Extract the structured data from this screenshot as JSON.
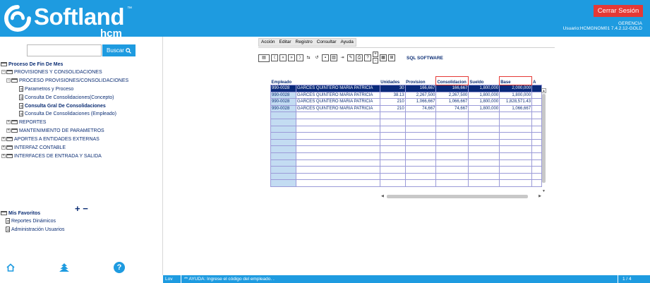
{
  "brand": {
    "name": "Softland",
    "tm": "™",
    "sub": "hcm"
  },
  "header": {
    "logout_label": "Cerrar Sesión",
    "area": "GERENCIA",
    "user_line": "Usuario:HCMGNOM01 7.4.2.12-GOLD"
  },
  "sidebar": {
    "search_placeholder": "",
    "search_label": "Buscar",
    "tree": [
      {
        "label": "Proceso De Fin De Mes",
        "bold": true
      },
      {
        "label": "PROVISIONES Y CONSOLIDACIONES"
      },
      {
        "label": "PROCESO PROVISIONES/CONSOLIDACIONES"
      },
      {
        "label": "Parametros y Proceso"
      },
      {
        "label": "Consulta De Consolidaciones(Concepto)"
      },
      {
        "label": "Consulta Gral De Consolidaciones",
        "bold": true
      },
      {
        "label": "Consulta De Consolidaciones (Empleado)"
      },
      {
        "label": "REPORTES"
      },
      {
        "label": "MANTENIMIENTO DE PARAMETROS"
      },
      {
        "label": "APORTES A ENTIDADES EXTERNAS"
      },
      {
        "label": "INTERFAZ CONTABLE"
      },
      {
        "label": "INTERFACES DE ENTRADA Y SALIDA"
      }
    ],
    "expand_collapse": "+ −",
    "favorites_title": "Mis Favoritos",
    "favorites": [
      {
        "label": "Reportes Dinámicos"
      },
      {
        "label": "Administración Usuarios"
      }
    ],
    "bottom_icons": [
      "home-icon",
      "tree-icon",
      "help-icon"
    ],
    "help_glyph": "?"
  },
  "menubar": {
    "items": [
      "Acción",
      "Editar",
      "Registro",
      "Consultar",
      "Ayuda"
    ]
  },
  "toolbar": {
    "brand": "SQL SOFTWARE"
  },
  "grid": {
    "headers": [
      "Empleado",
      "",
      "Unidades",
      "Provision",
      "Consolidacion",
      "Sueldo",
      "Base",
      "A"
    ],
    "rows": [
      [
        "990-0028",
        "GARCES QUINTERO MARIA PATRICIA",
        "30",
        "166,667",
        "166,667",
        "1,800,000",
        "2,000,000"
      ],
      [
        "990-0028",
        "GARCES QUINTERO MARIA PATRICIA",
        "38.13",
        "2,267,500",
        "2,267,500",
        "1,800,000",
        "1,800,000"
      ],
      [
        "990-0028",
        "GARCES QUINTERO MARIA PATRICIA",
        "210",
        "1,066,667",
        "1,066,667",
        "1,800,000",
        "1,828,571.43"
      ],
      [
        "990-0028",
        "GARCES QUINTERO MARIA PATRICIA",
        "210",
        "74,667",
        "74,667",
        "1,800,000",
        "1,066,667"
      ]
    ],
    "empty_rows": 11,
    "selected_row": 0
  },
  "status": {
    "lov": "Lov",
    "help": "** AYUDA: Ingrese el código del empleado. .",
    "page": "1 / 4"
  },
  "colors": {
    "brand_blue": "#1e9be0",
    "logout_red": "#e53935",
    "selected_row": "#0a2a7a",
    "text_navy": "#0d2f75"
  }
}
